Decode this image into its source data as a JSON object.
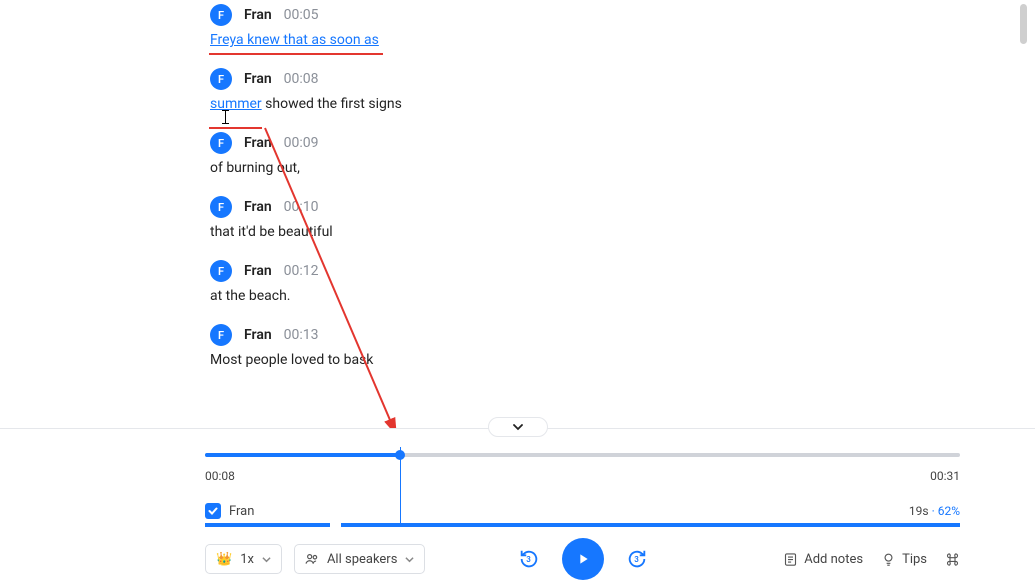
{
  "avatar_initial": "F",
  "speaker": "Fran",
  "transcript": [
    {
      "time": "00:05",
      "text": "Freya knew that as soon as",
      "highlight": true
    },
    {
      "time": "00:08",
      "text": "summer showed the first signs",
      "highlight": false
    },
    {
      "time": "00:09",
      "text": "of burning out,",
      "highlight": false
    },
    {
      "time": "00:10",
      "text": "that it'd be beautiful",
      "highlight": false
    },
    {
      "time": "00:12",
      "text": "at the beach.",
      "highlight": false
    },
    {
      "time": "00:13",
      "text": "Most people loved to bask",
      "highlight": false
    }
  ],
  "timeline": {
    "current_time": "00:08",
    "total_time": "00:31",
    "progress_pct": 25.8
  },
  "speaker_row": {
    "checked": true,
    "name": "Fran",
    "duration": "19s",
    "percent": "62%",
    "segments": [
      {
        "start_pct": 0,
        "width_pct": 16.5
      },
      {
        "start_pct": 18,
        "width_pct": 82
      }
    ]
  },
  "controls": {
    "speed_label": "1x",
    "speakers_label": "All speakers",
    "skip_seconds": "3",
    "add_notes_label": "Add notes",
    "tips_label": "Tips"
  }
}
